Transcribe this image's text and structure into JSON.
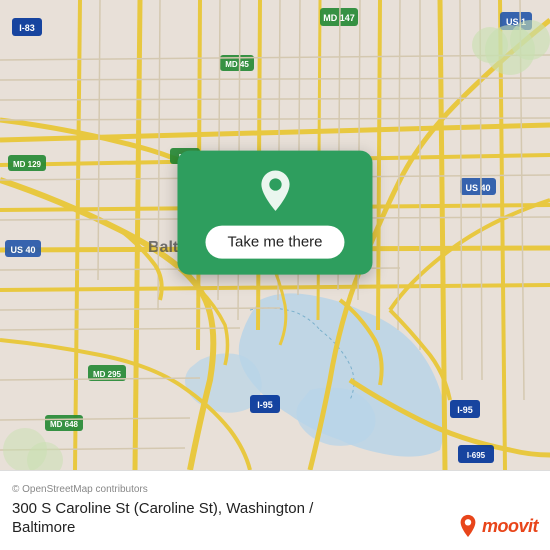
{
  "map": {
    "background_color": "#e8e0d8"
  },
  "popup": {
    "button_label": "Take me there",
    "pin_icon": "map-pin"
  },
  "bottom_bar": {
    "attribution": "© OpenStreetMap contributors",
    "location_line1": "300 S Caroline St (Caroline St), Washington /",
    "location_line2": "Baltimore"
  },
  "moovit": {
    "logo_text": "moovit"
  }
}
